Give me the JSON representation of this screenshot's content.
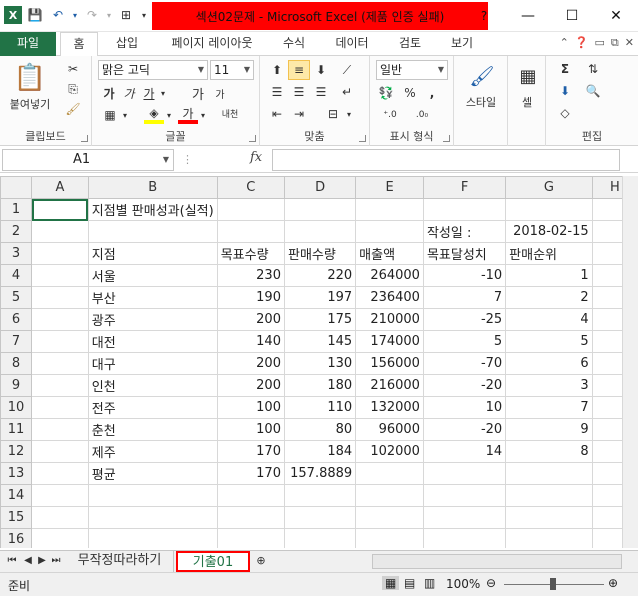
{
  "window": {
    "title": "섹션02문제 - Microsoft Excel (제품 인증 실패)",
    "minimize": "—",
    "maximize": "☐",
    "close": "✕"
  },
  "tabs": [
    "파일",
    "홈",
    "삽입",
    "페이지 레이아웃",
    "수식",
    "데이터",
    "검토",
    "보기"
  ],
  "ribbon": {
    "clipboard": {
      "paste": "붙여넣기",
      "label": "클립보드"
    },
    "font": {
      "name": "맑은 고딕",
      "size": "11",
      "label": "글꼴",
      "bold": "가",
      "italic": "가",
      "underline": "가",
      "grow": "가",
      "shrink": "가",
      "fontcolor": "가",
      "phonetic": "내천"
    },
    "align": {
      "label": "맞춤"
    },
    "number": {
      "format": "일반",
      "label": "표시 형식"
    },
    "styles": {
      "label": "스타일"
    },
    "cells": {
      "label": "셀"
    },
    "editing": {
      "label": "편집"
    }
  },
  "formula_bar": {
    "name_box": "A1",
    "fx": "fx",
    "value": ""
  },
  "columns": [
    "A",
    "B",
    "C",
    "D",
    "E",
    "F",
    "G",
    "H"
  ],
  "rows": [
    [
      "",
      "지점별 판매성과(실적)",
      "",
      "",
      "",
      "",
      "",
      ""
    ],
    [
      "",
      "",
      "",
      "",
      "",
      "작성일 :",
      "2018-02-15",
      ""
    ],
    [
      "",
      "지점",
      "목표수량",
      "판매수량",
      "매출액",
      "목표달성치",
      "판매순위",
      ""
    ],
    [
      "",
      "서울",
      "230",
      "220",
      "264000",
      "-10",
      "1",
      ""
    ],
    [
      "",
      "부산",
      "190",
      "197",
      "236400",
      "7",
      "2",
      ""
    ],
    [
      "",
      "광주",
      "200",
      "175",
      "210000",
      "-25",
      "4",
      ""
    ],
    [
      "",
      "대전",
      "140",
      "145",
      "174000",
      "5",
      "5",
      ""
    ],
    [
      "",
      "대구",
      "200",
      "130",
      "156000",
      "-70",
      "6",
      ""
    ],
    [
      "",
      "인천",
      "200",
      "180",
      "216000",
      "-20",
      "3",
      ""
    ],
    [
      "",
      "전주",
      "100",
      "110",
      "132000",
      "10",
      "7",
      ""
    ],
    [
      "",
      "춘천",
      "100",
      "80",
      "96000",
      "-20",
      "9",
      ""
    ],
    [
      "",
      "제주",
      "170",
      "184",
      "102000",
      "14",
      "8",
      ""
    ],
    [
      "",
      "평균",
      "170",
      "157.8889",
      "",
      "",
      "",
      ""
    ],
    [
      "",
      "",
      "",
      "",
      "",
      "",
      "",
      ""
    ],
    [
      "",
      "",
      "",
      "",
      "",
      "",
      "",
      ""
    ],
    [
      "",
      "",
      "",
      "",
      "",
      "",
      "",
      ""
    ],
    [
      "",
      "",
      "",
      "",
      "",
      "",
      "",
      ""
    ]
  ],
  "sheets": [
    "무작정따라하기",
    "기출01"
  ],
  "active_sheet": "기출01",
  "status": {
    "ready": "준비",
    "zoom": "100%"
  },
  "colors": {
    "excel_green": "#217346",
    "title_highlight": "#ff0000",
    "tab_highlight": "#ff0000"
  }
}
